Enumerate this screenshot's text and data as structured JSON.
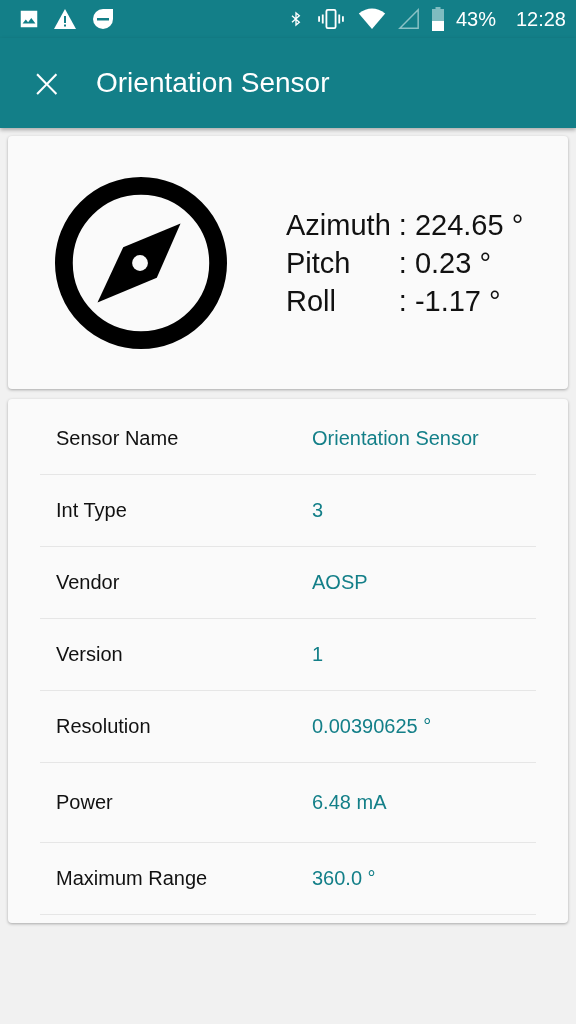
{
  "status_bar": {
    "battery": "43%",
    "time": "12:28"
  },
  "app_bar": {
    "close": "×",
    "title": "Orientation Sensor"
  },
  "readings": [
    {
      "label": "Azimuth",
      "value": ": 224.65 °"
    },
    {
      "label": "Pitch",
      "value": ": 0.23 °"
    },
    {
      "label": "Roll",
      "value": ": -1.17 °"
    }
  ],
  "details": [
    {
      "label": "Sensor Name",
      "value": "Orientation Sensor"
    },
    {
      "label": "Int Type",
      "value": "3"
    },
    {
      "label": "Vendor",
      "value": "AOSP"
    },
    {
      "label": "Version",
      "value": "1"
    },
    {
      "label": "Resolution",
      "value": "0.00390625 °"
    },
    {
      "label": "Power",
      "value": "6.48 mA"
    },
    {
      "label": "Maximum Range",
      "value": "360.0 °"
    }
  ]
}
